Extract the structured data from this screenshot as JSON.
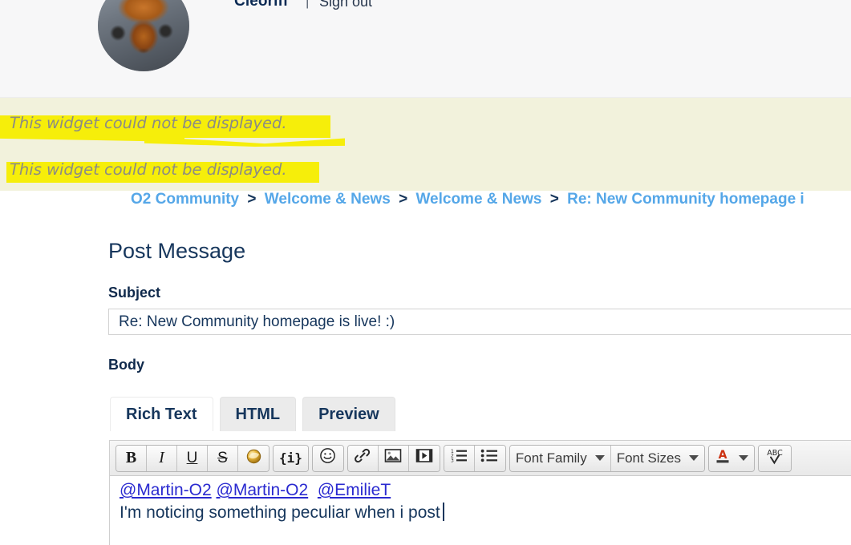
{
  "header": {
    "username": "Cleoriff",
    "separator": "|",
    "signout_label": "Sign out",
    "avatar_icon": "fox-avatar"
  },
  "widget_errors": {
    "line1": "This widget could not be displayed.",
    "line2": "This widget could not be displayed.",
    "highlight_color": "#f6ee0a",
    "band_color": "#f2f2dc",
    "text_color": "#8c8c84"
  },
  "breadcrumb": {
    "separator": ">",
    "items": [
      "O2 Community",
      "Welcome & News",
      "Welcome & News",
      "Re: New Community homepage i"
    ],
    "link_color": "#55a7e8"
  },
  "form": {
    "page_title": "Post Message",
    "subject_label": "Subject",
    "subject_value": "Re: New Community homepage is live! :)",
    "subject_placeholder": "Subject",
    "body_label": "Body"
  },
  "editor": {
    "tabs": [
      {
        "label": "Rich Text",
        "active": true
      },
      {
        "label": "HTML",
        "active": false
      },
      {
        "label": "Preview",
        "active": false
      }
    ],
    "toolbar": {
      "bold": "B",
      "italic": "I",
      "underline": "U",
      "strikethrough": "S",
      "highlight_icon": "highlighter-icon",
      "insert_code": "{i}",
      "emoticon_icon": "☺",
      "link_icon": "link-icon",
      "image_icon": "image-icon",
      "video_icon": "video-icon",
      "ordered_list_icon": "ordered-list-icon",
      "bullet_list_icon": "bullet-list-icon",
      "font_family_label": "Font Family",
      "font_sizes_label": "Font Sizes",
      "text_color_icon": "A",
      "spellcheck_icon": "ABC"
    },
    "body": {
      "mentions": [
        "@Martin-O2",
        "@Martin-O2",
        "@EmilieT"
      ],
      "line2": "I'm noticing something peculiar when i post",
      "mention_color": "#2a2ad0",
      "text_color": "#16365c"
    }
  }
}
